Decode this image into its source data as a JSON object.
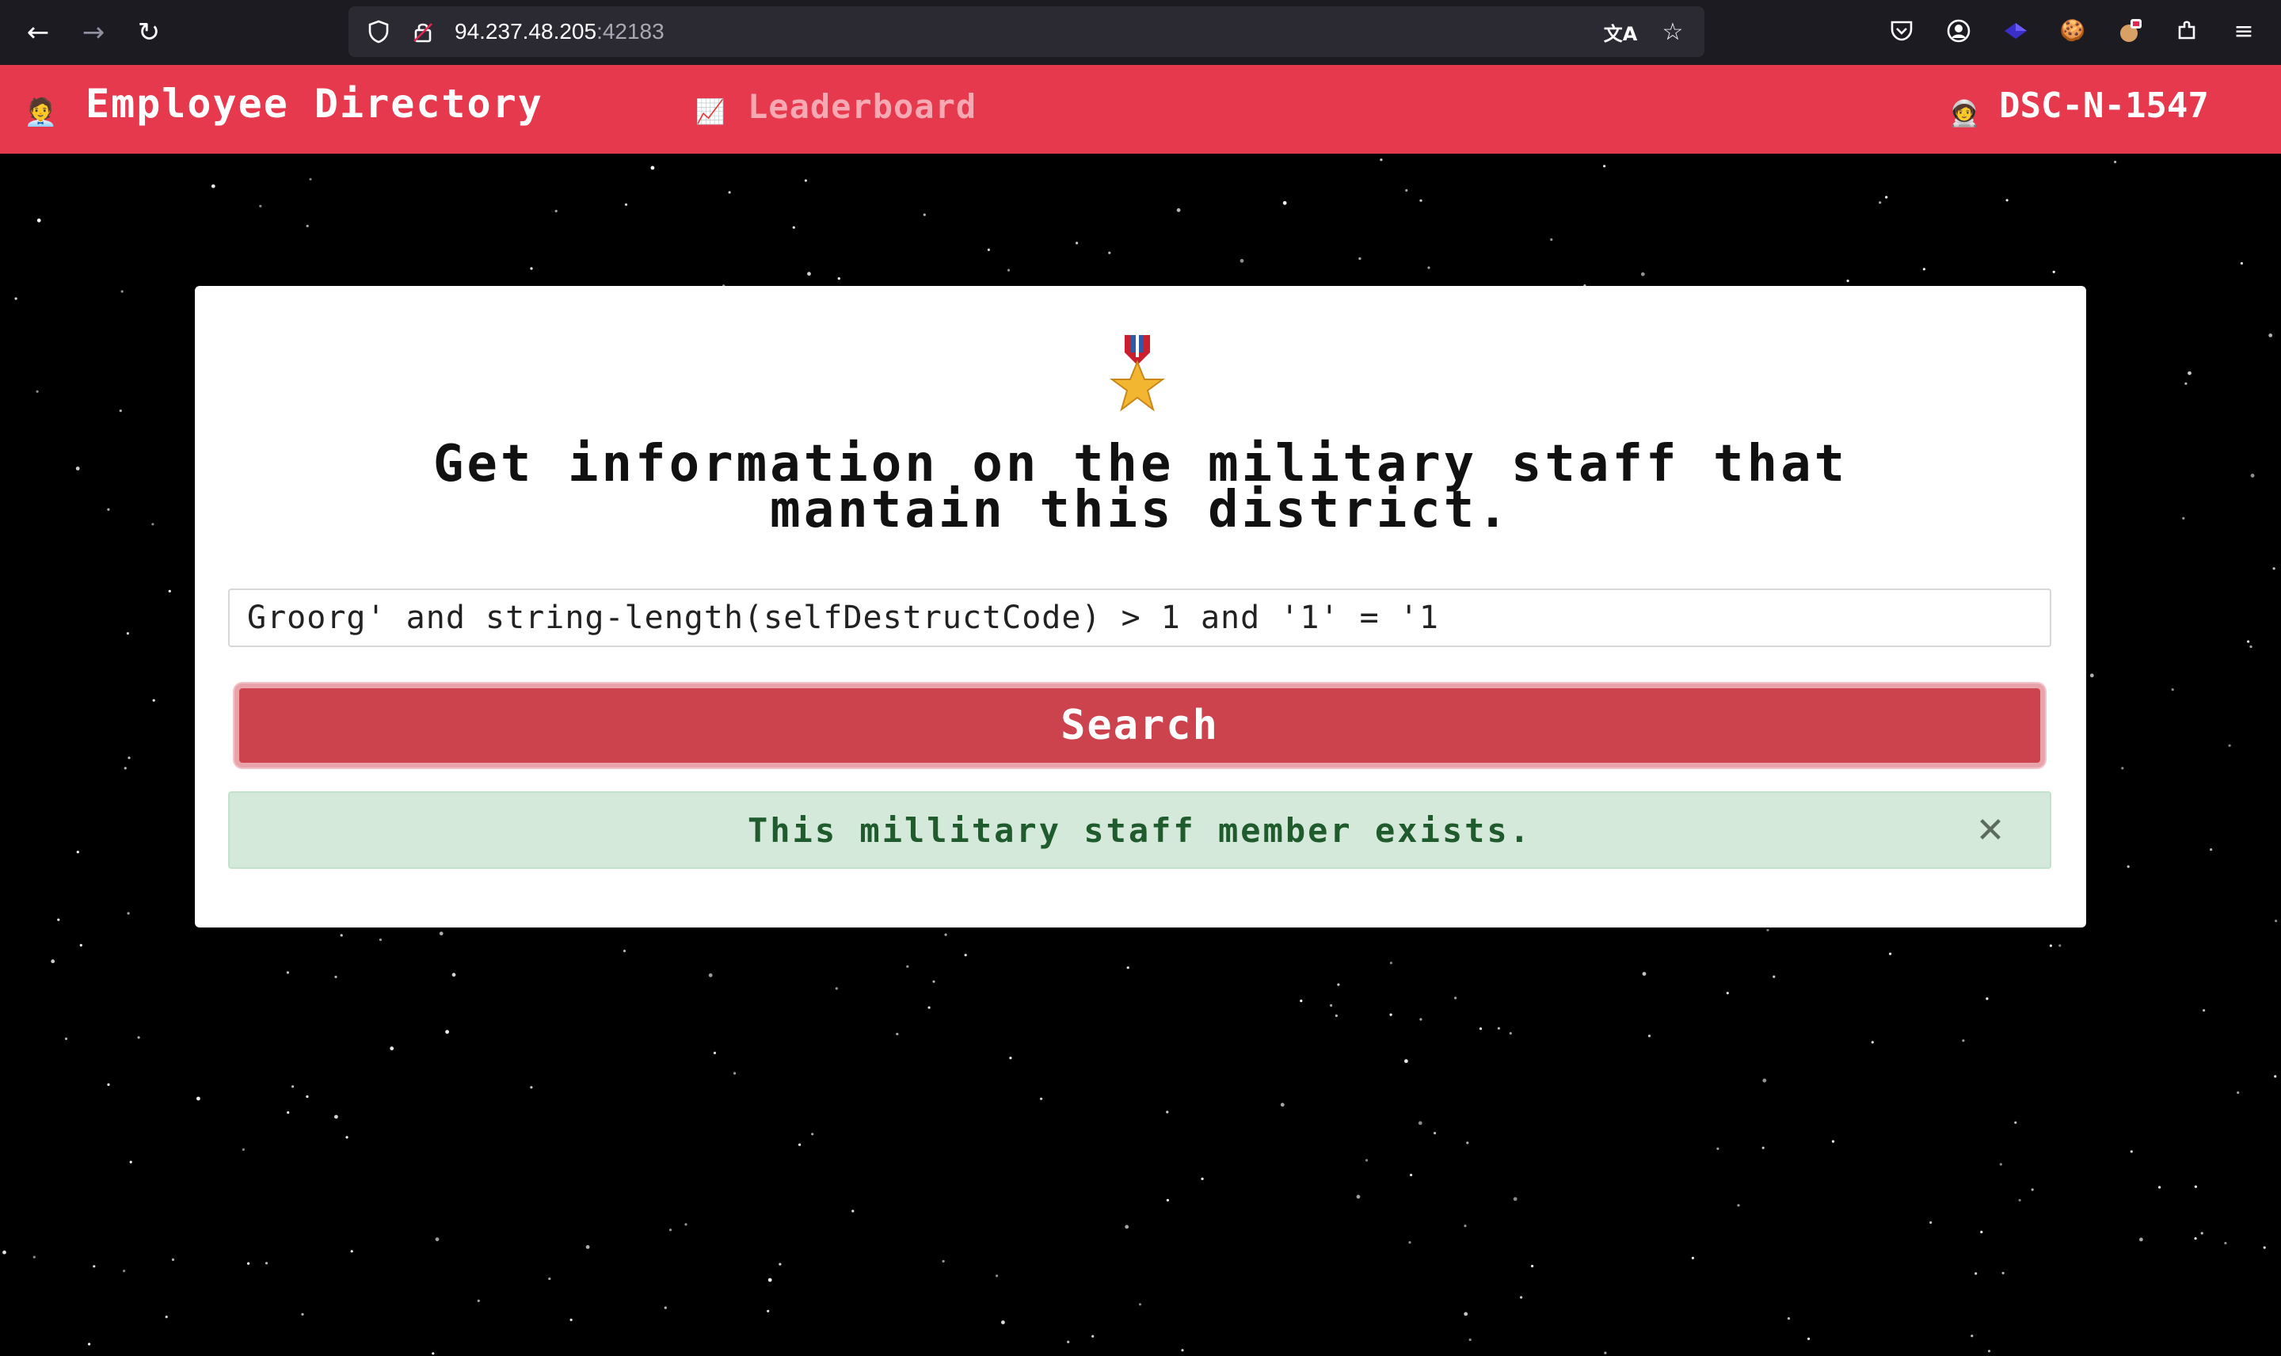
{
  "browser": {
    "back_icon": "←",
    "forward_icon": "→",
    "reload_icon": "↻",
    "shield_icon": "⛉",
    "lock_icon": "🔒",
    "url_host": "94.237.48.205",
    "url_port": ":42183",
    "translate_icon": "文A",
    "bookmark_icon": "☆",
    "pocket_icon": "⛉",
    "account_icon": "◉",
    "ext1_icon": "◆",
    "cookie_icon": "🍪",
    "ext3_icon": "◈",
    "extensions_icon": "⧉",
    "menu_icon": "≡"
  },
  "navbar": {
    "brand_icon": "🧑‍💼",
    "brand": "Employee Directory",
    "leaderboard_icon": "📈",
    "leaderboard": "Leaderboard",
    "user_icon": "🧑‍🚀",
    "user_code": "DSC-N-1547"
  },
  "card": {
    "heading_line1": "Get information on the military staff that",
    "heading_line2": "mantain this district.",
    "query_value": "Groorg' and string-length(selfDestructCode) > 1 and '1' = '1",
    "search_label": "Search",
    "alert_text": "This millitary staff member exists.",
    "alert_close": "✕"
  },
  "colors": {
    "navbar_bg": "#e7394d",
    "button_bg": "#cc434e",
    "alert_bg": "#d4e9d9",
    "alert_text": "#1f5b2d"
  }
}
